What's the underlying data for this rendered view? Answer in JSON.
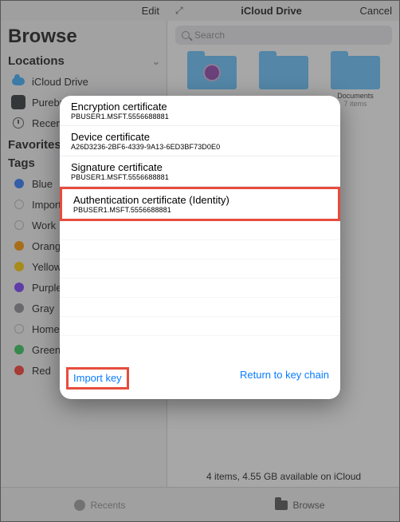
{
  "header_left": {
    "edit": "Edit"
  },
  "header_right": {
    "title": "iCloud Drive",
    "cancel": "Cancel"
  },
  "search": {
    "placeholder": "Search"
  },
  "sidebar": {
    "browse_title": "Browse",
    "locations_label": "Locations",
    "favorites_label": "Favorites",
    "tags_label": "Tags",
    "locations": [
      {
        "label": "iCloud Drive",
        "icon": "icloud"
      },
      {
        "label": "Purebr",
        "icon": "app-tile"
      },
      {
        "label": "Recent",
        "icon": "clock"
      }
    ],
    "tags": [
      {
        "label": "Blue",
        "color": "#2d7bff",
        "filled": true
      },
      {
        "label": "Importa",
        "color": "#cccccc",
        "filled": false
      },
      {
        "label": "Work",
        "color": "#cccccc",
        "filled": false
      },
      {
        "label": "Orange",
        "color": "#ff9500",
        "filled": true
      },
      {
        "label": "Yellow",
        "color": "#ffcc00",
        "filled": true
      },
      {
        "label": "Purple",
        "color": "#7d3cff",
        "filled": true
      },
      {
        "label": "Gray",
        "color": "#8e8e93",
        "filled": true
      },
      {
        "label": "Home",
        "color": "#cccccc",
        "filled": false
      },
      {
        "label": "Green",
        "color": "#34c759",
        "filled": true
      },
      {
        "label": "Red",
        "color": "#ff3b30",
        "filled": true
      }
    ]
  },
  "content": {
    "folders": [
      {
        "name": "",
        "sub": "",
        "badge": true
      },
      {
        "name": "",
        "sub": "",
        "badge": false
      },
      {
        "name": "Documents",
        "sub": "7 items",
        "badge": false
      }
    ],
    "status": "4 items, 4.55 GB available on iCloud"
  },
  "tabs": {
    "recents": "Recents",
    "browse": "Browse"
  },
  "modal": {
    "certs": [
      {
        "title": "Encryption certificate",
        "sub": "PBUSER1.MSFT.5556688881"
      },
      {
        "title": "Device certificate",
        "sub": "A26D3236-2BF6-4339-9A13-6ED3BF73D0E0"
      },
      {
        "title": "Signature certificate",
        "sub": "PBUSER1.MSFT.5556688881"
      },
      {
        "title": "Authentication certificate (Identity)",
        "sub": "PBUSER1.MSFT.5556688881",
        "highlight": true
      }
    ],
    "import_label": "Import key",
    "return_label": "Return to key chain"
  }
}
